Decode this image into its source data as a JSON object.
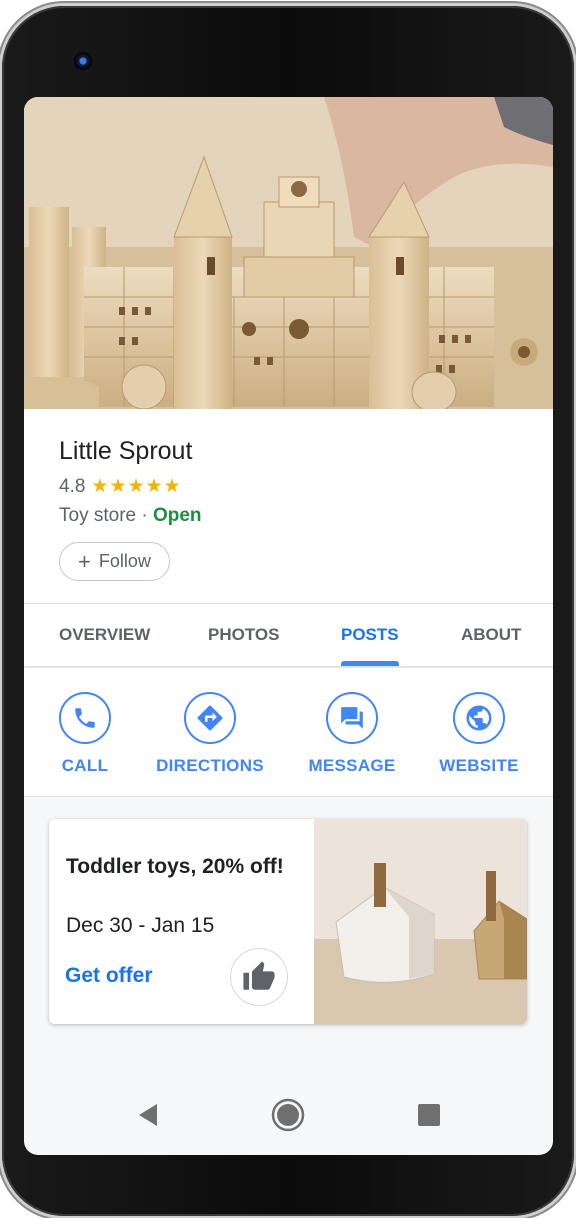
{
  "business": {
    "name": "Little Sprout",
    "rating": "4.8",
    "stars": "★★★★★",
    "type": "Toy store",
    "separator": " · ",
    "status": "Open"
  },
  "follow": {
    "plus": "+",
    "label": "Follow"
  },
  "tabs": [
    {
      "label": "OVERVIEW",
      "active": false
    },
    {
      "label": "PHOTOS",
      "active": false
    },
    {
      "label": "POSTS",
      "active": true
    },
    {
      "label": "ABOUT",
      "active": false
    }
  ],
  "actions": [
    {
      "label": "CALL",
      "icon": "phone-icon"
    },
    {
      "label": "DIRECTIONS",
      "icon": "directions-icon"
    },
    {
      "label": "MESSAGE",
      "icon": "message-icon"
    },
    {
      "label": "WEBSITE",
      "icon": "globe-icon"
    }
  ],
  "post": {
    "title": "Toddler toys, 20% off!",
    "dates": "Dec 30 - Jan 15",
    "cta": "Get offer"
  },
  "colors": {
    "accent": "#4285f4",
    "link": "#1a73e8",
    "open_green": "#1e8e3e",
    "star": "#f4b400"
  },
  "nav": {
    "back": "back-icon",
    "home": "home-icon",
    "recents": "recents-icon"
  }
}
